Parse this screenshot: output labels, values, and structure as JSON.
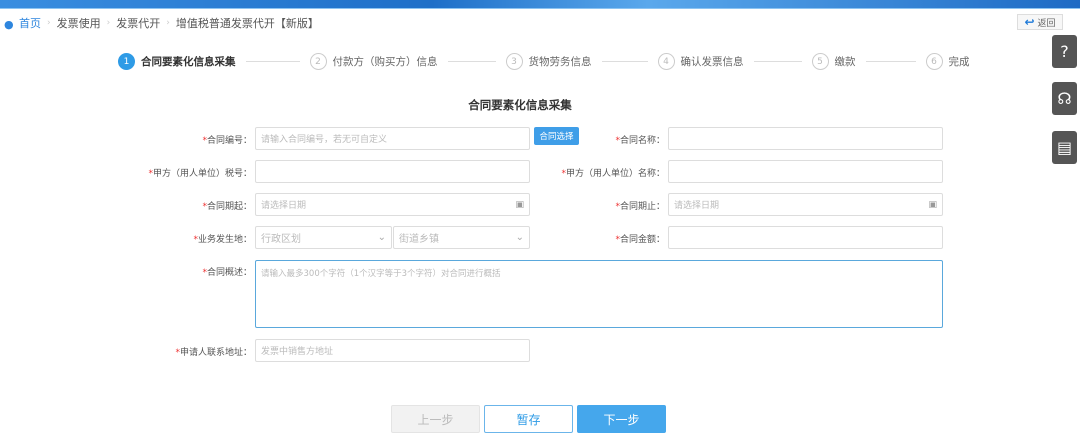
{
  "breadcrumb": {
    "home": "首页",
    "items": [
      "发票使用",
      "发票代开",
      "增值税普通发票代开【新版】"
    ]
  },
  "back_label": "返回",
  "steps": [
    {
      "num": "1",
      "label": "合同要素化信息采集"
    },
    {
      "num": "2",
      "label": "付款方（购买方）信息"
    },
    {
      "num": "3",
      "label": "货物劳务信息"
    },
    {
      "num": "4",
      "label": "确认发票信息"
    },
    {
      "num": "5",
      "label": "缴款"
    },
    {
      "num": "6",
      "label": "完成"
    }
  ],
  "form": {
    "title": "合同要素化信息采集",
    "contract_no": {
      "label": "合同编号：",
      "placeholder": "请输入合同编号，若无可自定义"
    },
    "contract_select": "合同选择",
    "contract_name": {
      "label": "合同名称：",
      "value": ""
    },
    "party_a_tax": {
      "label": "甲方（用人单位）税号：",
      "value": ""
    },
    "party_a_name": {
      "label": "甲方（用人单位）名称：",
      "value": ""
    },
    "start": {
      "label": "合同期起：",
      "placeholder": "请选择日期"
    },
    "end": {
      "label": "合同期止：",
      "placeholder": "请选择日期"
    },
    "place": {
      "label": "业务发生地：",
      "district": "行政区划",
      "street": "街道乡镇"
    },
    "amount": {
      "label": "合同金额：",
      "value": ""
    },
    "summary": {
      "label": "合同概述：",
      "placeholder": "请输入最多300个字符（1个汉字等于3个字符）对合同进行概括"
    },
    "address": {
      "label": "申请人联系地址：",
      "placeholder": "发票中销售方地址"
    }
  },
  "buttons": {
    "prev": "上一步",
    "save": "暂存",
    "next": "下一步"
  }
}
